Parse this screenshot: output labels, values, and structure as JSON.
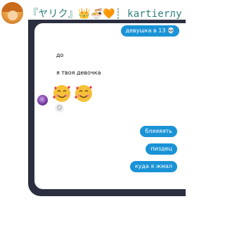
{
  "header": {
    "title": "『ヤリク』👑🍜🧡┊ kartierлу"
  },
  "messages": {
    "out_1": "девушка в 13 💀",
    "in_1": "до",
    "in_2": "я твоя девочка",
    "out_2": "бляяяять",
    "out_3": "пиздец",
    "out_4": "куда я жмал"
  },
  "icons": {
    "reaction": "add-reaction-icon",
    "emoji": "smiling-face-with-hearts-icon"
  },
  "colors": {
    "accent": "#1a93d6",
    "panel": "#2b2f3f",
    "title": "#2e7f7b"
  }
}
